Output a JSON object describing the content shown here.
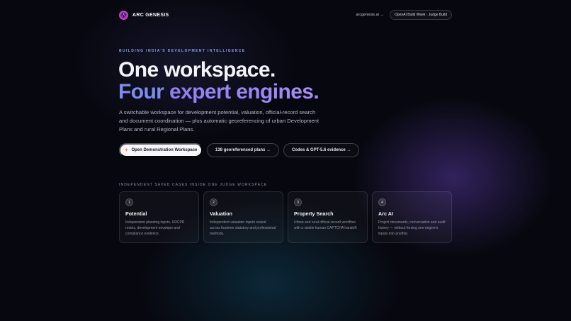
{
  "nav": {
    "brand": "ARC GENESIS",
    "link": "arcgenesis.ai →",
    "pill": "OpenAI Build Week · Judge Build"
  },
  "hero": {
    "eyebrow": "BUILDING INDIA’S DEVELOPMENT INTELLIGENCE",
    "line1": "One workspace.",
    "line2_a": "Four",
    "line2_b": "expert engines.",
    "description": "A switchable workspace for development potential, valuation, official-record search and document coordination — plus automatic georeferencing of urban Development Plans and rural Regional Plans."
  },
  "ctas": {
    "primary": "Open Demonstration Workspace",
    "secondary": "138 georeferenced plans →",
    "tertiary": "Codes & GPT-5.6 evidence →"
  },
  "section_label": "INDEPENDENT SAVED CASES INSIDE ONE JUDGE WORKSPACE",
  "cards": [
    {
      "num": "1",
      "title": "Potential",
      "body": "Independent planning inputs, UDCPR routes, development envelope and compliance evidence."
    },
    {
      "num": "2",
      "title": "Valuation",
      "body": "Independent valuation inputs routed across fourteen statutory and professional methods."
    },
    {
      "num": "3",
      "title": "Property Search",
      "body": "Urban and rural official-record workflow with a visible human CAPTCHA handoff."
    },
    {
      "num": "4",
      "title": "Arc AI",
      "body": "Project documents, conversation and audit history — without forcing one engine’s inputs into another."
    }
  ],
  "colors": {
    "accent": "#7c8cf0",
    "logo": "#d13cb8",
    "background": "#07080f"
  },
  "icons": {
    "logo": "arc-logo-icon",
    "primary_cta": "sparkle-icon"
  }
}
